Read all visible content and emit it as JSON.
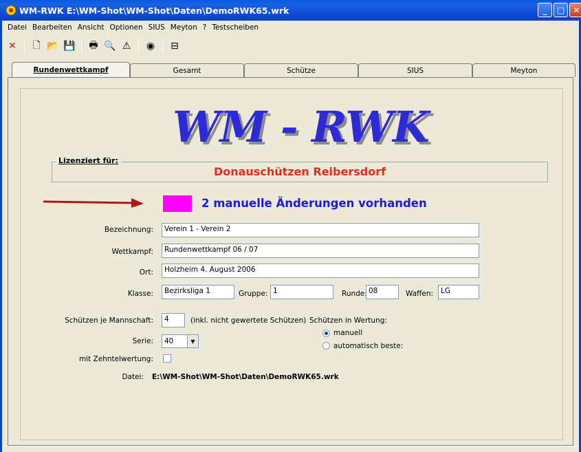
{
  "window": {
    "title": "WM-RWK E:\\WM-Shot\\WM-Shot\\Daten\\DemoRWK65.wrk"
  },
  "menu": [
    "Datei",
    "Bearbeiten",
    "Ansicht",
    "Optionen",
    "SIUS",
    "Meyton",
    "?",
    "Testscheiben"
  ],
  "toolbar": {
    "icons": [
      "close-icon",
      "new-document-icon",
      "open-folder-icon",
      "save-icon",
      "print-icon",
      "print-preview-icon",
      "pdf-icon",
      "target-icon",
      "printer-icon"
    ]
  },
  "tabs": [
    "Rundenwettkampf",
    "Gesamt",
    "Schütze",
    "SIUS",
    "Meyton"
  ],
  "active_tab": "Rundenwettkampf",
  "logo": "WM - RWK",
  "license": {
    "legend": "Lizenziert für:",
    "name": "Donauschützen Reibersdorf"
  },
  "changes": {
    "text": "2 manuelle Änderungen vorhanden",
    "marker_color": "#ff00ff"
  },
  "form": {
    "bezeichnung_label": "Bezeichnung:",
    "bezeichnung_value": "Verein 1 - Verein 2",
    "wettkampf_label": "Wettkampf:",
    "wettkampf_value": "Rundenwettkampf 06 / 07",
    "ort_label": "Ort:",
    "ort_value": "Holzheim 4. August 2006",
    "klasse_label": "Klasse:",
    "klasse_value": "Bezirksliga 1",
    "gruppe_label": "Gruppe:",
    "gruppe_value": "1",
    "runde_label": "Runde:",
    "runde_value": "08",
    "waffen_label": "Waffen:",
    "waffen_value": "LG",
    "schuetzen_label": "Schützen je Mannschaft:",
    "schuetzen_value": "4",
    "schuetzen_note": "(inkl. nicht gewertete Schützen)",
    "wertung_label": "Schützen in Wertung:",
    "wertung_manuell": "manuell",
    "wertung_auto": "automatisch beste:",
    "serie_label": "Serie:",
    "serie_value": "40",
    "zehntel_label": "mit Zehntelwertung:",
    "datei_label": "Datei:",
    "datei_value": "E:\\WM-Shot\\WM-Shot\\Daten\\DemoRWK65.wrk"
  },
  "colors": {
    "license_text": "#e32c1c",
    "changes_text": "#1c1ae0",
    "logo": "#2e2ad8",
    "titlebar": "#0e4fd8"
  }
}
